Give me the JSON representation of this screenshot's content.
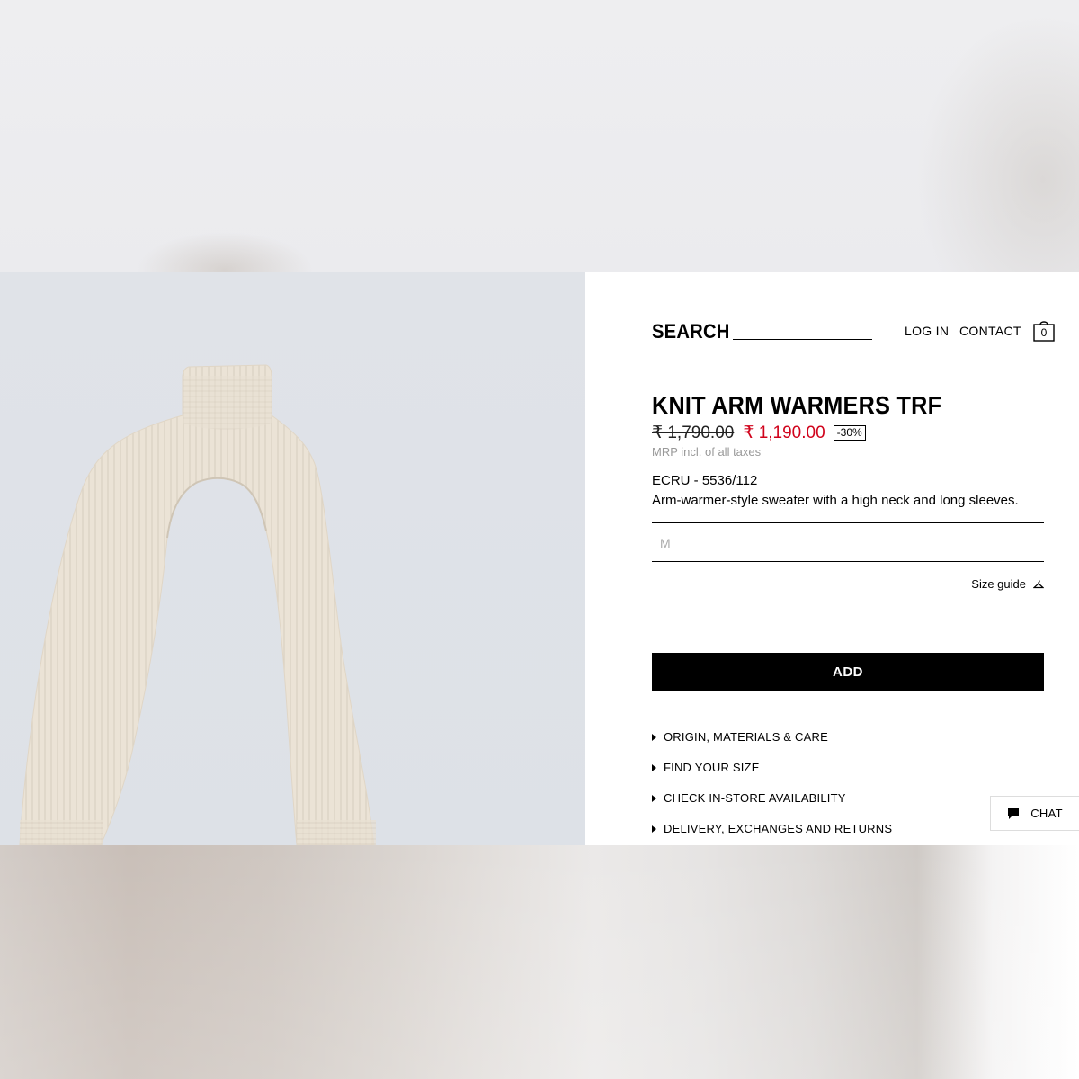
{
  "header": {
    "search_label": "SEARCH",
    "search_value": "",
    "login_label": "LOG IN",
    "contact_label": "CONTACT",
    "cart_count": "0"
  },
  "product": {
    "title": "KNIT ARM WARMERS TRF",
    "old_price": "₹ 1,790.00",
    "new_price": "₹ 1,190.00",
    "discount": "-30%",
    "tax_note": "MRP incl. of all taxes",
    "color_ref": "ECRU - 5536/112",
    "description": "Arm-warmer-style sweater with a high neck and long sleeves.",
    "size_selected": "M",
    "size_guide_label": "Size guide",
    "add_label": "ADD"
  },
  "accordion": [
    "ORIGIN, MATERIALS & CARE",
    "FIND YOUR SIZE",
    "CHECK IN-STORE AVAILABILITY",
    "DELIVERY, EXCHANGES AND RETURNS"
  ],
  "chat": {
    "label": "CHAT"
  },
  "colors": {
    "sale_red": "#d0021b",
    "garment": "#ebe3d6"
  },
  "icons": {
    "cart": "shopping-bag-icon",
    "size_guide": "hanger-icon",
    "chat": "chat-bubble-icon",
    "accordion": "caret-right-icon"
  }
}
